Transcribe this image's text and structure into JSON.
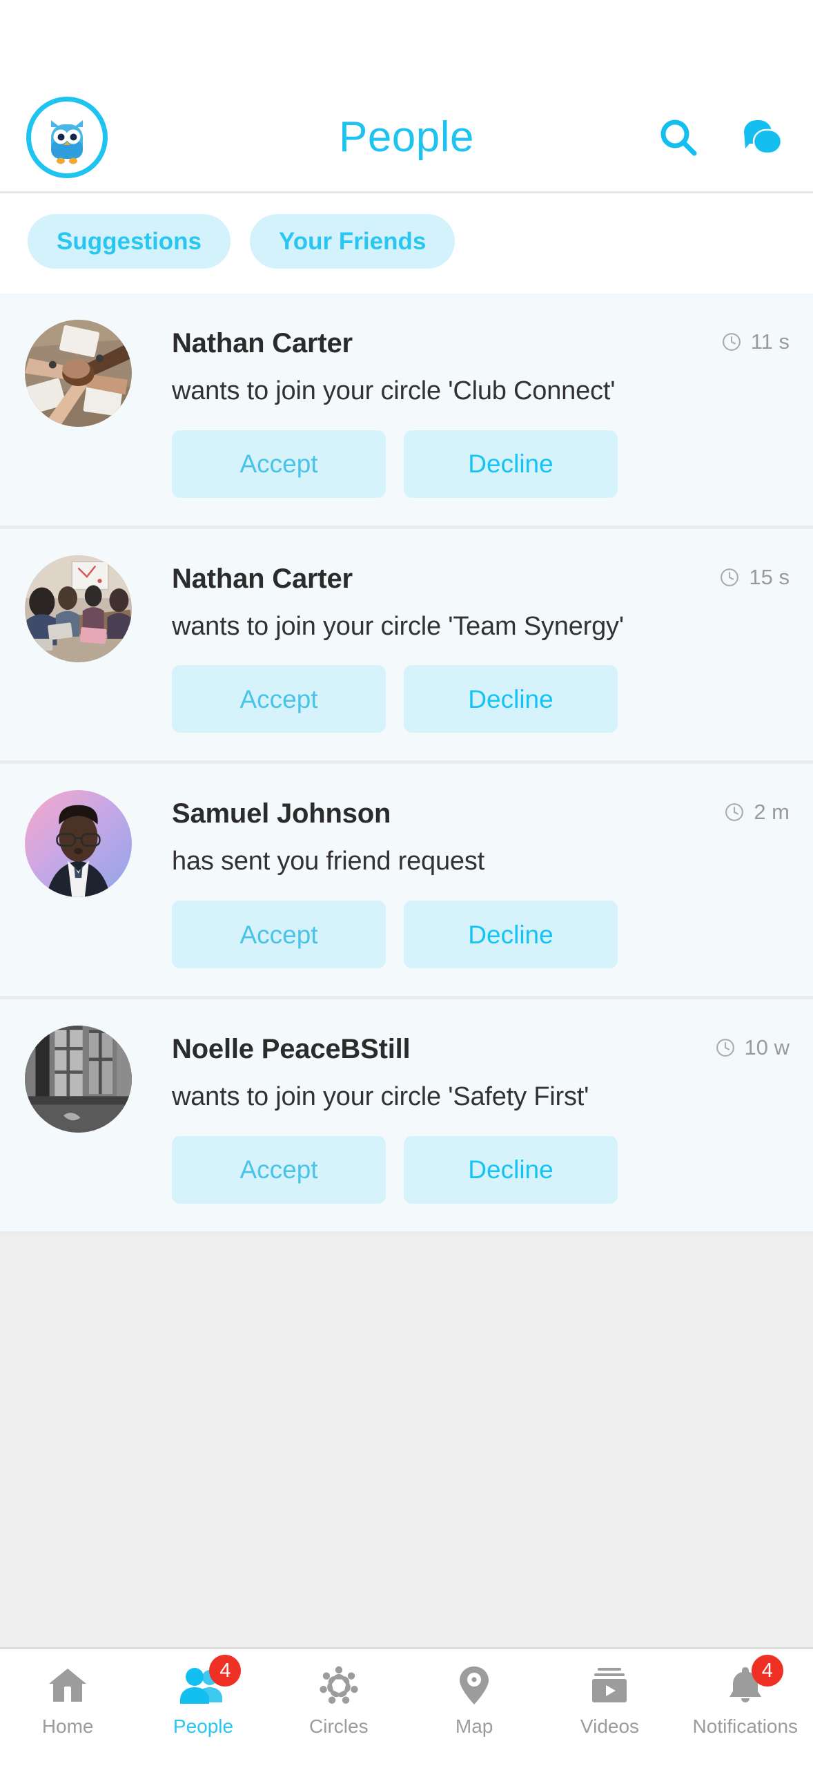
{
  "colors": {
    "accent": "#1FC3F0",
    "accent_soft": "#29C6F2",
    "chip_bg": "#D4F2FB",
    "button_bg": "#D6F2FB",
    "accept_text": "#4AC3E8",
    "decline_text": "#13C4F5",
    "badge_red": "#EE3124",
    "row_bg": "#F4FAFC",
    "page_bg": "#EFEFEF",
    "muted_text": "#9A9A9A"
  },
  "header": {
    "logo_icon": "owl-logo-icon",
    "title": "People",
    "search_icon": "search-icon",
    "messages_icon": "chat-bubbles-icon"
  },
  "filters": {
    "chips": [
      {
        "label": "Suggestions",
        "selected": true
      },
      {
        "label": "Your Friends",
        "selected": false
      }
    ]
  },
  "requests": {
    "accept_label": "Accept",
    "decline_label": "Decline",
    "time_icon": "clock-icon",
    "items": [
      {
        "name": "Nathan Carter",
        "message": "wants to join your circle 'Club Connect'",
        "time": "11 s",
        "avatar": "photo-hands-together"
      },
      {
        "name": "Nathan Carter",
        "message": "wants to join your circle 'Team Synergy'",
        "time": "15 s",
        "avatar": "photo-meeting-room"
      },
      {
        "name": "Samuel Johnson",
        "message": "has sent you friend request",
        "time": "2 m",
        "avatar": "photo-man-glasses-suit"
      },
      {
        "name": "Noelle PeaceBStill",
        "message": "wants to join your circle 'Safety First'",
        "time": "10 w",
        "avatar": "photo-building-bw"
      }
    ]
  },
  "bottom_nav": {
    "items": [
      {
        "label": "Home",
        "icon": "home-icon",
        "active": false,
        "badge": null
      },
      {
        "label": "People",
        "icon": "people-icon",
        "active": true,
        "badge": "4"
      },
      {
        "label": "Circles",
        "icon": "circles-icon",
        "active": false,
        "badge": null
      },
      {
        "label": "Map",
        "icon": "map-pin-icon",
        "active": false,
        "badge": null
      },
      {
        "label": "Videos",
        "icon": "videos-icon",
        "active": false,
        "badge": null
      },
      {
        "label": "Notifications",
        "icon": "bell-icon",
        "active": true,
        "badge": "4"
      }
    ]
  }
}
